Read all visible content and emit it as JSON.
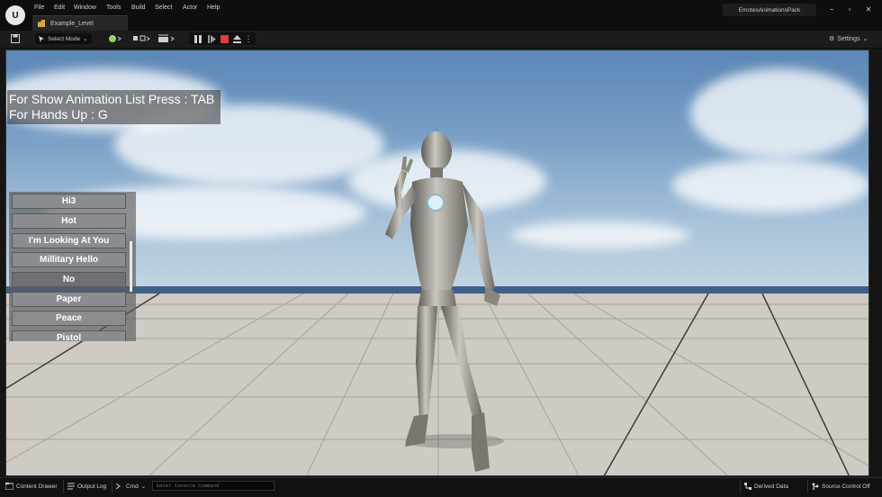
{
  "app": {
    "logo_text": "U",
    "menu": [
      "File",
      "Edit",
      "Window",
      "Tools",
      "Build",
      "Select",
      "Actor",
      "Help"
    ],
    "level_tab": "Example_Level",
    "project_name": "EmotesAnimationsPack",
    "window_controls": {
      "minimize": "−",
      "maximize": "▫",
      "close": "✕"
    }
  },
  "toolbar": {
    "save_icon": "save-icon",
    "select_mode_label": "Select Mode",
    "settings_label": "Settings",
    "chevron": "⌄"
  },
  "viewport": {
    "help_lines": [
      "For Show Animation List Press : TAB",
      "For Hands Up : G"
    ],
    "animation_list": [
      "Hi3",
      "Hot",
      "I'm Looking At You",
      "Millitary Hello",
      "No",
      "Paper",
      "Peace",
      "Pistol"
    ],
    "highlighted_item": "No"
  },
  "statusbar": {
    "content_drawer": "Content Drawer",
    "output_log": "Output Log",
    "cmd_label": "Cmd",
    "console_placeholder": "Enter Console Command",
    "derived_data": "Derived Data",
    "source_control": "Source Control Off"
  },
  "colors": {
    "accent_stop": "#e23b3b",
    "panel_dark": "#1c1c1c",
    "sky": "#7da3c9"
  }
}
